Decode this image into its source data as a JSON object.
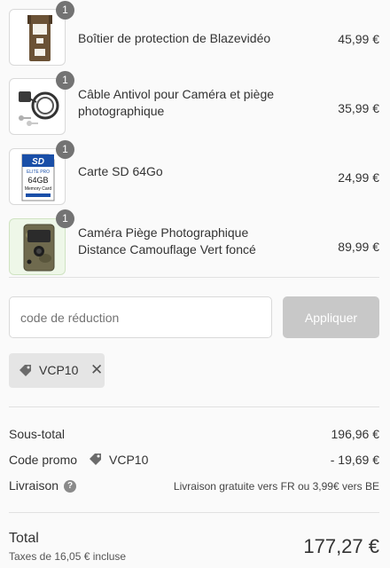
{
  "items": [
    {
      "quantity": "1",
      "name": "Boîtier de protection de Blazevidéo",
      "price": "45,99 €",
      "thumb_icon": "security-box-icon"
    },
    {
      "quantity": "1",
      "name": "Câble Antivol pour Caméra et piège photographique",
      "price": "35,99 €",
      "thumb_icon": "lock-cable-icon"
    },
    {
      "quantity": "1",
      "name": "Carte SD 64Go",
      "price": "24,99 €",
      "thumb_icon": "sd-card-icon",
      "card_text": {
        "brand": "SD",
        "line": "ELITE PRO",
        "capacity": "64GB",
        "caption": "Memory Card"
      }
    },
    {
      "quantity": "1",
      "name": "Caméra Piège Photographique Distance Camouflage Vert foncé",
      "price": "89,99 €",
      "thumb_icon": "trail-camera-icon"
    }
  ],
  "discount": {
    "placeholder": "code de réduction",
    "apply_label": "Appliquer",
    "applied_code": "VCP10",
    "remove_symbol": "✕"
  },
  "summary": {
    "subtotal_label": "Sous-total",
    "subtotal_value": "196,96 €",
    "promo_label": "Code promo",
    "promo_code": "VCP10",
    "promo_value": "- 19,69 €",
    "shipping_label": "Livraison",
    "shipping_help": "?",
    "shipping_value": "Livraison gratuite vers FR ou 3,99€ vers BE"
  },
  "total": {
    "label": "Total",
    "tax_note": "Taxes de 16,05 € incluse",
    "amount": "177,27 €"
  },
  "colors": {
    "apply_disabled": "#c8c8c8",
    "quantity_badge": "#737373",
    "tag_background": "#e5e5e5"
  }
}
